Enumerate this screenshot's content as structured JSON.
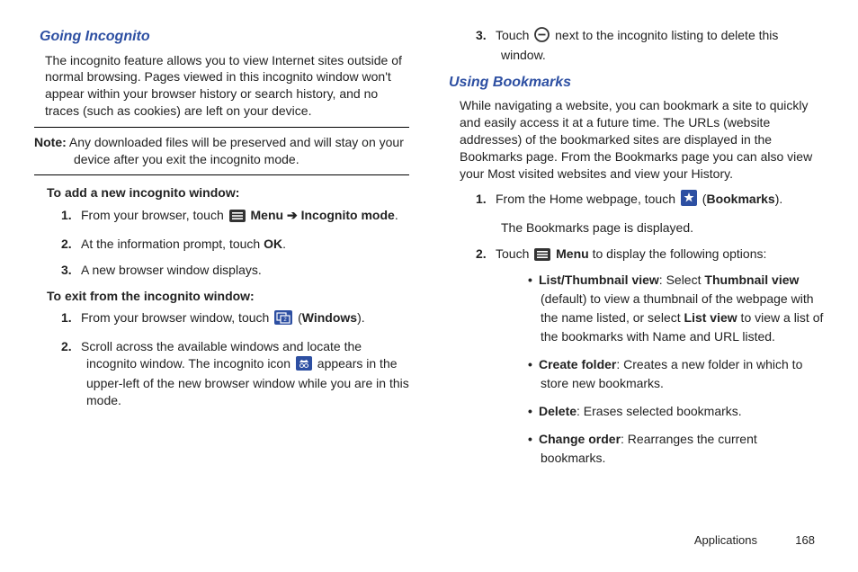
{
  "left": {
    "heading1": "Going Incognito",
    "p1": "The incognito feature allows you to view Internet sites outside of normal browsing. Pages viewed in this incognito window won't appear within your browser history or search history, and no traces (such as cookies) are left on your device.",
    "note_label": "Note:",
    "note_text": " Any downloaded files will be preserved and will stay on your device after you exit the incognito mode.",
    "sub1": "To add a new incognito window:",
    "step1a_pre": "From your browser, touch ",
    "step1a_b1": "Menu",
    "step1a_arrow": " ➔ ",
    "step1a_b2": "Incognito mode",
    "step1a_post": ".",
    "step2a_pre": "At the information prompt, touch ",
    "step2a_b1": "OK",
    "step2a_post": ".",
    "step3a": "A new browser window displays.",
    "sub2": "To exit from the incognito window:",
    "step1b_pre": "From your browser window, touch ",
    "step1b_label": "Windows",
    "step1b_post": ").",
    "step1b_open": " (",
    "step2b_pre": "Scroll across the available windows and locate the incognito window. The incognito icon ",
    "step2b_post": " appears in the upper-left of the new browser window while you are in this mode."
  },
  "right": {
    "step3_pre": "Touch ",
    "step3_post": " next to the incognito listing to delete this window.",
    "heading2": "Using Bookmarks",
    "p2": "While navigating a website, you can bookmark a site to quickly and easily access it at a future time. The URLs (website addresses) of the bookmarked sites are displayed in the Bookmarks page. From the Bookmarks page you can also view your Most visited websites and view your History.",
    "r1_pre": "From the Home webpage, touch ",
    "r1_open": " (",
    "r1_label": "Bookmarks",
    "r1_close": ").",
    "r1_after": "The Bookmarks page is displayed.",
    "r2_pre": "Touch ",
    "r2_menu": "Menu",
    "r2_post": " to display the following options:",
    "b1_lead": "List/Thumbnail view",
    "b1_mid": ": Select ",
    "b1_th": "Thumbnail view",
    "b1_mid2": " (default) to view a thumbnail of the webpage with the name listed, or select ",
    "b1_lv": "List view",
    "b1_tail": " to view a list of the bookmarks with Name and URL listed.",
    "b2_lead": "Create folder",
    "b2_tail": ": Creates a new folder in which to store new bookmarks.",
    "b3_lead": "Delete",
    "b3_tail": ": Erases selected bookmarks.",
    "b4_lead": "Change order",
    "b4_tail": ": Rearranges the current bookmarks."
  },
  "nums": {
    "n1": "1.",
    "n2": "2.",
    "n3": "3."
  },
  "bullet": "•",
  "footer": {
    "section": "Applications",
    "page": "168"
  }
}
